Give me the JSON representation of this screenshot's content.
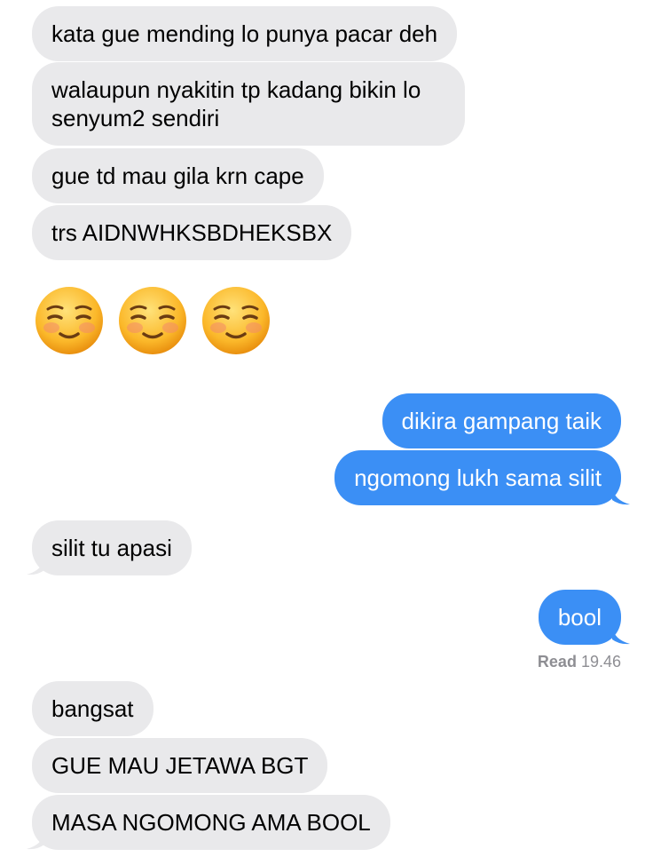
{
  "conversation": {
    "messages": [
      {
        "direction": "received",
        "text": "kata gue mending lo punya pacar deh"
      },
      {
        "direction": "received",
        "text": "walaupun nyakitin tp kadang bikin lo senyum2 sendiri"
      },
      {
        "direction": "received",
        "text": "gue td mau gila krn cape"
      },
      {
        "direction": "received",
        "text": "trs AIDNWHKSBDHEKSBX"
      },
      {
        "direction": "received",
        "text": "☺️☺️☺️"
      },
      {
        "direction": "sent",
        "text": "dikira gampang taik"
      },
      {
        "direction": "sent",
        "text": "ngomong lukh sama silit"
      },
      {
        "direction": "received",
        "text": "silit tu apasi"
      },
      {
        "direction": "sent",
        "text": "bool"
      },
      {
        "direction": "received",
        "text": "bangsat"
      },
      {
        "direction": "received",
        "text": "GUE MAU JETAWA BGT"
      },
      {
        "direction": "received",
        "text": "MASA NGOMONG AMA BOOL"
      }
    ],
    "receipt": {
      "label": "Read",
      "time": "19.46"
    }
  },
  "colors": {
    "received_bubble": "#e9e9eb",
    "sent_bubble": "#3b8ff5",
    "receipt_text": "#8e8e93"
  }
}
